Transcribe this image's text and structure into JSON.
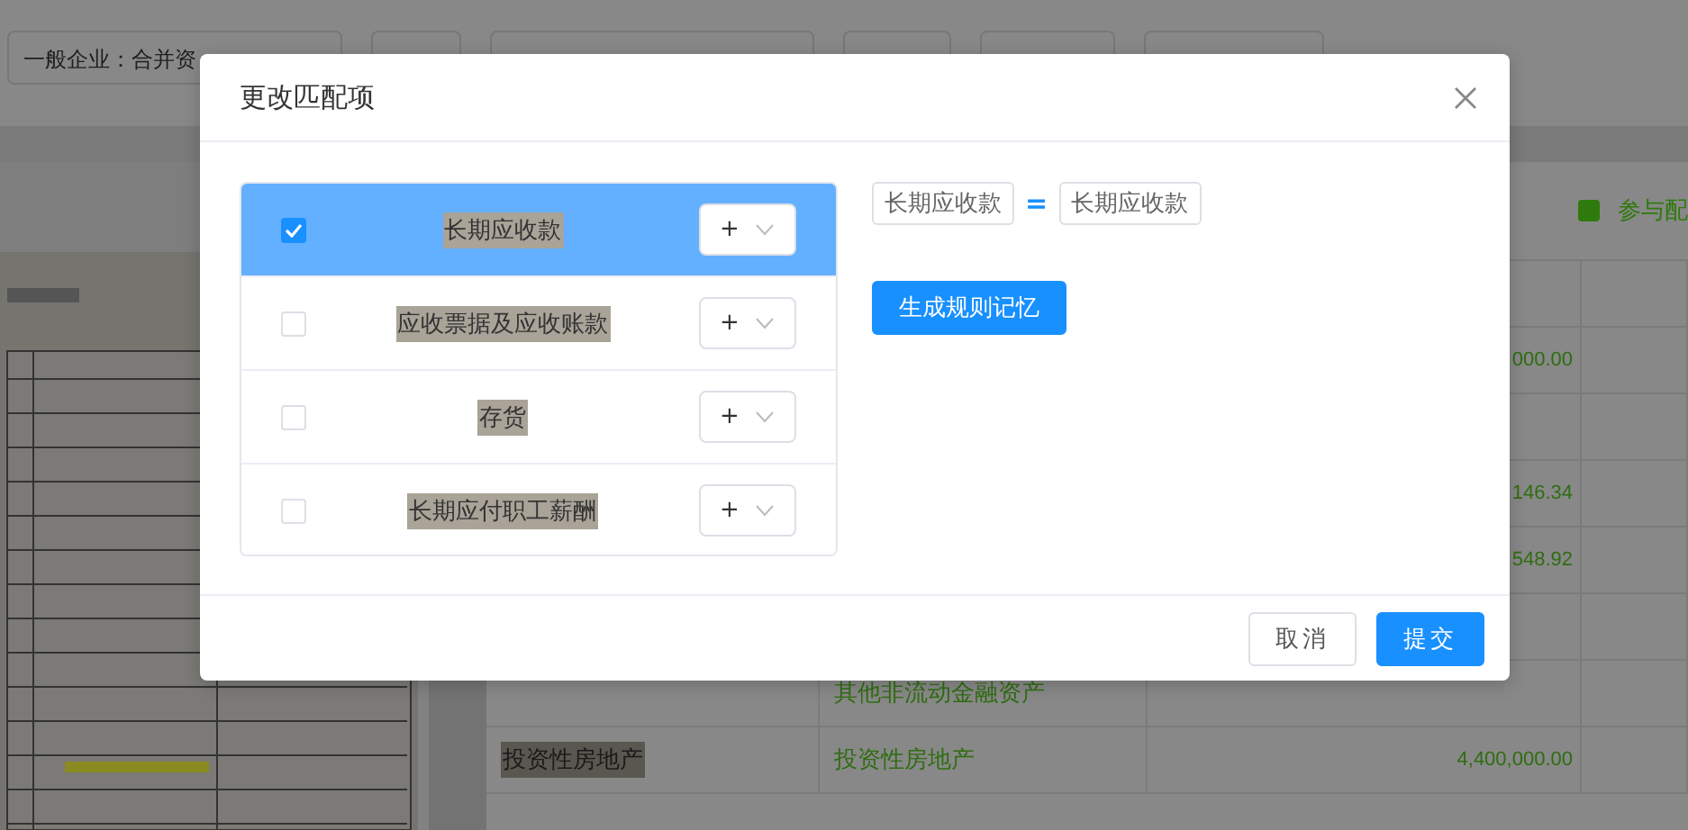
{
  "background": {
    "toolbar": {
      "first_button": "一般企业：合并资"
    },
    "legend": {
      "label": "参与配",
      "color": "#2f7a0c"
    },
    "table_rows": [
      {},
      {
        "amount": "000.00"
      },
      {},
      {
        "amount": "146.34"
      },
      {
        "amount": "548.92"
      },
      {},
      {
        "mapped": "其他非流动金融资产"
      },
      {
        "account": "投资性房地产",
        "mapped": "投资性房地产",
        "amount": "4,400,000.00"
      }
    ]
  },
  "dialog": {
    "title": "更改匹配项",
    "match_items": [
      {
        "label": "长期应收款",
        "checked": true,
        "operator": "+"
      },
      {
        "label": "应收票据及应收账款",
        "checked": false,
        "operator": "+"
      },
      {
        "label": "存货",
        "checked": false,
        "operator": "+"
      },
      {
        "label": "长期应付职工薪酬",
        "checked": false,
        "operator": "+"
      }
    ],
    "formula": {
      "left": "长期应收款",
      "operator": "=",
      "right": "长期应收款"
    },
    "generate_button": "生成规则记忆",
    "footer_buttons": [
      {
        "label": "取消",
        "kind": "default"
      },
      {
        "label": "提交",
        "kind": "primary"
      }
    ]
  }
}
